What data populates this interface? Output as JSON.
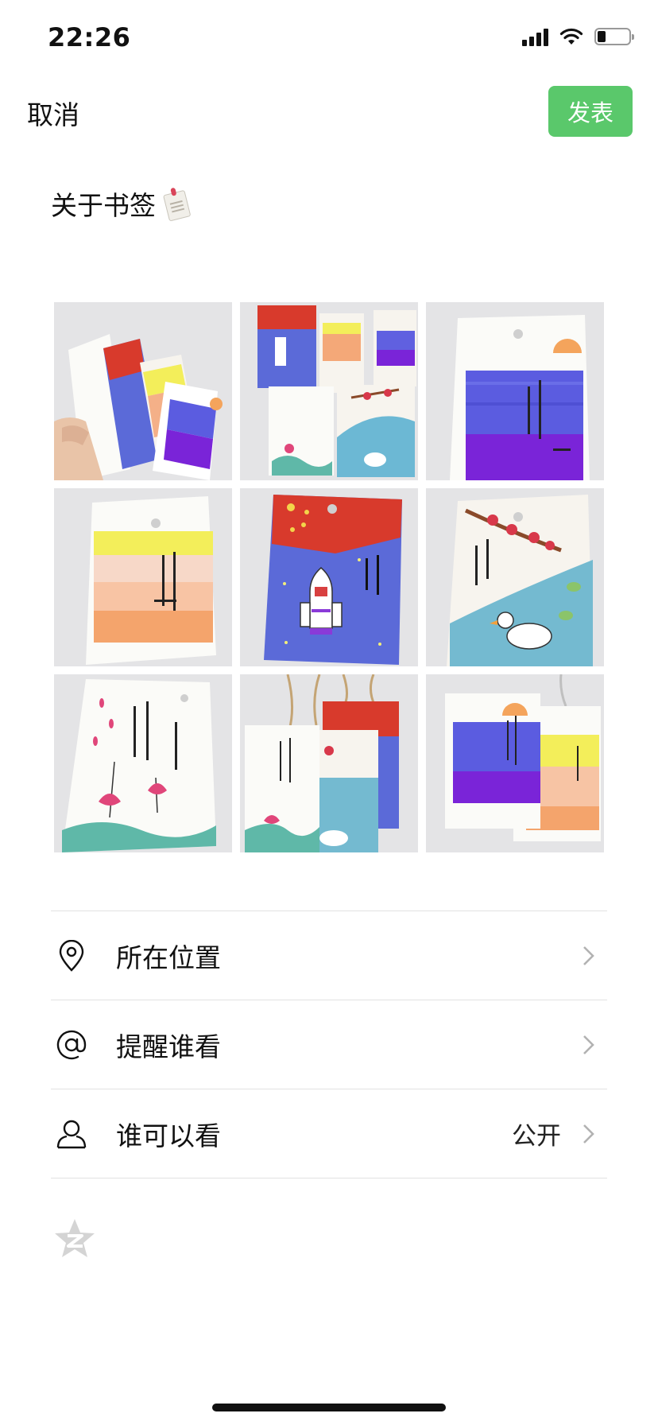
{
  "status_bar": {
    "time": "22:26",
    "icons": [
      "signal-icon",
      "wifi-icon",
      "battery-icon"
    ],
    "battery_level": 0.25
  },
  "header": {
    "cancel_label": "取消",
    "publish_label": "发表",
    "publish_color": "#5ac86b"
  },
  "post": {
    "text": "关于书签",
    "emoji": "bookmark-icon"
  },
  "photos": [
    {
      "name": "photo-1"
    },
    {
      "name": "photo-2"
    },
    {
      "name": "photo-3"
    },
    {
      "name": "photo-4"
    },
    {
      "name": "photo-5"
    },
    {
      "name": "photo-6"
    },
    {
      "name": "photo-7"
    },
    {
      "name": "photo-8"
    },
    {
      "name": "photo-9"
    }
  ],
  "options": [
    {
      "label": "所在位置",
      "icon": "location-pin-icon",
      "value": ""
    },
    {
      "label": "提醒谁看",
      "icon": "at-icon",
      "value": ""
    },
    {
      "label": "谁可以看",
      "icon": "person-icon",
      "value": "公开"
    }
  ],
  "footer": {
    "icon": "qzone-star-icon"
  }
}
